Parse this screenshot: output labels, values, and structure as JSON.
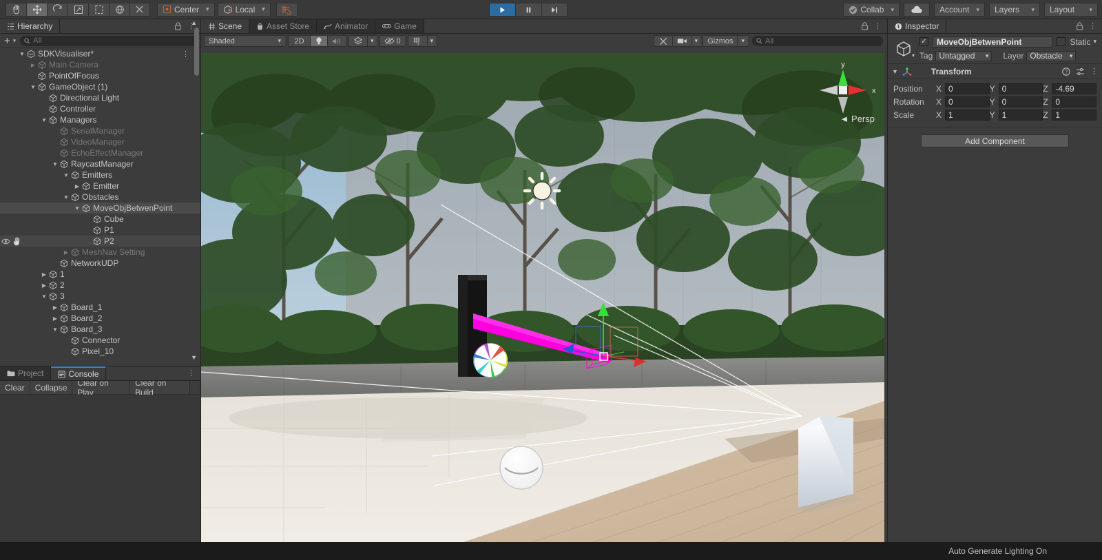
{
  "toolbar": {
    "tools": [
      {
        "name": "hand-tool",
        "icon": "hand",
        "active": false
      },
      {
        "name": "move-tool",
        "icon": "move",
        "active": true
      },
      {
        "name": "rotate-tool",
        "icon": "rotate",
        "active": false
      },
      {
        "name": "scale-tool",
        "icon": "scale",
        "active": false
      },
      {
        "name": "rect-tool",
        "icon": "rect",
        "active": false
      },
      {
        "name": "transform-tool",
        "icon": "transform",
        "active": false
      },
      {
        "name": "custom-tool",
        "icon": "wrench",
        "active": false
      }
    ],
    "pivot_mode": "Center",
    "pivot_rotation": "Local",
    "play": "▶",
    "pause": "❚❚",
    "step": "▶❘",
    "collab": "Collab",
    "cloud": "cloud-icon",
    "account": "Account",
    "layers": "Layers",
    "layout": "Layout"
  },
  "hierarchy": {
    "tab": "Hierarchy",
    "search_placeholder": "All",
    "create_label": "+",
    "items": [
      {
        "label": "SDKVisualiser*",
        "depth": 0,
        "arrow": "down",
        "dim": false,
        "selected": false,
        "scene": true,
        "kebab": true
      },
      {
        "label": "Main Camera",
        "depth": 1,
        "arrow": "right",
        "dim": true,
        "selected": false
      },
      {
        "label": "PointOfFocus",
        "depth": 1,
        "arrow": "none",
        "dim": false,
        "selected": false
      },
      {
        "label": "GameObject (1)",
        "depth": 1,
        "arrow": "down",
        "dim": false,
        "selected": false
      },
      {
        "label": "Directional Light",
        "depth": 2,
        "arrow": "none",
        "dim": false,
        "selected": false
      },
      {
        "label": "Controller",
        "depth": 2,
        "arrow": "none",
        "dim": false,
        "selected": false
      },
      {
        "label": "Managers",
        "depth": 2,
        "arrow": "down",
        "dim": false,
        "selected": false
      },
      {
        "label": "SerialManager",
        "depth": 3,
        "arrow": "none",
        "dim": true,
        "selected": false
      },
      {
        "label": "VideoManager",
        "depth": 3,
        "arrow": "none",
        "dim": true,
        "selected": false
      },
      {
        "label": "EchoEffectManager",
        "depth": 3,
        "arrow": "none",
        "dim": true,
        "selected": false
      },
      {
        "label": "RaycastManager",
        "depth": 3,
        "arrow": "down",
        "dim": false,
        "selected": false
      },
      {
        "label": "Emitters",
        "depth": 4,
        "arrow": "down",
        "dim": false,
        "selected": false
      },
      {
        "label": "Emitter",
        "depth": 5,
        "arrow": "right",
        "dim": false,
        "selected": false
      },
      {
        "label": "Obstacles",
        "depth": 4,
        "arrow": "down",
        "dim": false,
        "selected": false
      },
      {
        "label": "MoveObjBetwenPoint",
        "depth": 5,
        "arrow": "down",
        "dim": false,
        "selected": true
      },
      {
        "label": "Cube",
        "depth": 6,
        "arrow": "none",
        "dim": false,
        "selected": false
      },
      {
        "label": "P1",
        "depth": 6,
        "arrow": "none",
        "dim": false,
        "selected": false
      },
      {
        "label": "P2",
        "depth": 6,
        "arrow": "none",
        "dim": false,
        "selected": false,
        "hover": true,
        "eye": true
      },
      {
        "label": "MeshNav Setting",
        "depth": 4,
        "arrow": "right",
        "dim": true,
        "selected": false
      },
      {
        "label": "NetworkUDP",
        "depth": 3,
        "arrow": "none",
        "dim": false,
        "selected": false
      },
      {
        "label": "1",
        "depth": 2,
        "arrow": "right",
        "dim": false,
        "selected": false
      },
      {
        "label": "2",
        "depth": 2,
        "arrow": "right",
        "dim": false,
        "selected": false
      },
      {
        "label": "3",
        "depth": 2,
        "arrow": "down",
        "dim": false,
        "selected": false
      },
      {
        "label": "Board_1",
        "depth": 3,
        "arrow": "right",
        "dim": false,
        "selected": false
      },
      {
        "label": "Board_2",
        "depth": 3,
        "arrow": "right",
        "dim": false,
        "selected": false
      },
      {
        "label": "Board_3",
        "depth": 3,
        "arrow": "down",
        "dim": false,
        "selected": false
      },
      {
        "label": "Connector",
        "depth": 4,
        "arrow": "none",
        "dim": false,
        "selected": false
      },
      {
        "label": "Pixel_10",
        "depth": 4,
        "arrow": "none",
        "dim": false,
        "selected": false
      }
    ]
  },
  "bottom_panel": {
    "tabs": [
      {
        "label": "Project",
        "icon": "folder-icon",
        "active": false
      },
      {
        "label": "Console",
        "icon": "console-icon",
        "active": true
      }
    ],
    "console_buttons": [
      "Clear",
      "Collapse",
      "Clear on Play",
      "Clear on Build"
    ]
  },
  "scene": {
    "tabs": [
      {
        "label": "Scene",
        "icon": "grid-icon",
        "active": true
      },
      {
        "label": "Asset Store",
        "icon": "store-icon",
        "active": false
      },
      {
        "label": "Animator",
        "icon": "animator-icon",
        "active": false
      },
      {
        "label": "Game",
        "icon": "gamepad-icon",
        "active": false
      }
    ],
    "draw_mode": "Shaded",
    "twod_label": "2D",
    "lighting_toggle": "light-bulb-icon",
    "audio_toggle": "speaker-icon",
    "fx_label": "fx-icon",
    "hidden_count": "0",
    "grid_label": "grid-visibility-icon",
    "gizmos_label": "Gizmos",
    "gizmos_search_placeholder": "All",
    "camera_icon": "camera-icon",
    "tools_icon": "scene-tools-icon",
    "gizmo_axes": {
      "y": "y",
      "x": "x",
      "perspective": "Persp"
    }
  },
  "inspector": {
    "tab": "Inspector",
    "object_name": "MoveObjBetwenPoint",
    "enabled": true,
    "static_label": "Static",
    "tag_label": "Tag",
    "tag_value": "Untagged",
    "layer_label": "Layer",
    "layer_value": "Obstacle",
    "component": {
      "title": "Transform",
      "rows": [
        {
          "label": "Position",
          "x": "0",
          "y": "0",
          "z": "-4.69"
        },
        {
          "label": "Rotation",
          "x": "0",
          "y": "0",
          "z": "0"
        },
        {
          "label": "Scale",
          "x": "1",
          "y": "1",
          "z": "1"
        }
      ],
      "axis_labels": [
        "X",
        "Y",
        "Z"
      ]
    },
    "add_component": "Add Component"
  },
  "status": {
    "message": "Auto Generate Lighting On"
  },
  "colors": {
    "accent_blue": "#2b6ca3",
    "panel_bg": "#3c3c3c",
    "toolbar_bg": "#393939",
    "beam_magenta": "#ff00e0",
    "axis_green": "#39e639",
    "axis_red": "#e03030",
    "axis_blue": "#2b52d8"
  }
}
